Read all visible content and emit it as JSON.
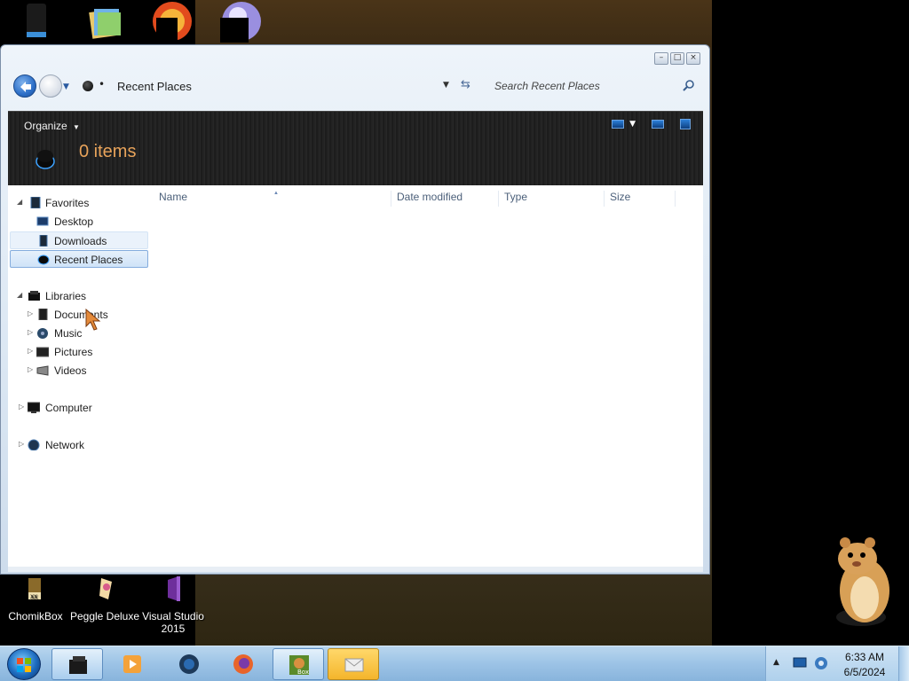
{
  "window": {
    "address_location": "Recent Places",
    "search_placeholder": "Search Recent Places",
    "organize_label": "Organize",
    "items_count": "0 items"
  },
  "columns": [
    "Name",
    "Date modified",
    "Type",
    "Size"
  ],
  "nav": {
    "favorites": {
      "label": "Favorites",
      "items": [
        "Desktop",
        "Downloads",
        "Recent Places"
      ]
    },
    "libraries": {
      "label": "Libraries",
      "items": [
        "Documents",
        "Music",
        "Pictures",
        "Videos"
      ]
    },
    "computer": "Computer",
    "network": "Network"
  },
  "desktop_icons": [
    {
      "label": "ChomikBox",
      "icon": "chomikbox-icon"
    },
    {
      "label": "Peggle Deluxe",
      "icon": "peggle-icon"
    },
    {
      "label": "Visual Studio 2015",
      "icon": "visual-studio-icon"
    }
  ],
  "taskbar": {
    "time": "6:33 AM",
    "date": "6/5/2024",
    "buttons": [
      "explorer",
      "media-player",
      "browser",
      "firefox",
      "box-game",
      "mail"
    ]
  },
  "colors": {
    "accent": "#2d6fc8",
    "items_count": "#e8a35a",
    "selection": "#cfe3f8"
  }
}
